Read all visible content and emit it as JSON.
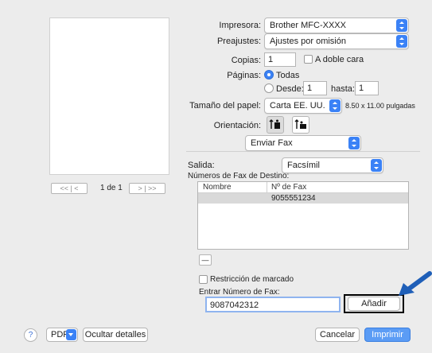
{
  "printer": {
    "label": "Impresora:",
    "value": "Brother MFC-XXXX"
  },
  "presets": {
    "label": "Preajustes:",
    "value": "Ajustes por omisión"
  },
  "copies": {
    "label": "Copias:",
    "value": "1",
    "duplex_label": "A doble cara"
  },
  "pages": {
    "label": "Páginas:",
    "all_label": "Todas",
    "from_label": "Desde:",
    "from_value": "1",
    "to_label": "hasta:",
    "to_value": "1"
  },
  "paper": {
    "label": "Tamaño del papel:",
    "value": "Carta EE. UU.",
    "dims": "8.50 x 11.00 pulgadas"
  },
  "orientation": {
    "label": "Orientación:"
  },
  "section": {
    "value": "Enviar Fax"
  },
  "output": {
    "label": "Salida:",
    "value": "Facsímil"
  },
  "fax_table": {
    "title": "Números de Fax de Destino:",
    "col_name": "Nombre",
    "col_fax": "Nº de Fax",
    "rows": [
      {
        "name": "",
        "fax": "9055551234"
      }
    ]
  },
  "remove_button": "—",
  "dial_restriction": {
    "label": "Restricción de marcado"
  },
  "enter_fax": {
    "label": "Entrar Número de Fax:",
    "value": "9087042312",
    "add_label": "Añadir"
  },
  "pager": {
    "first_prev": "<<",
    "prev": "<",
    "text": "1 de 1",
    "next": ">",
    "last": ">>"
  },
  "bottom": {
    "help": "?",
    "pdf": "PDF",
    "hide_details": "Ocultar detalles",
    "cancel": "Cancelar",
    "print": "Imprimir"
  },
  "colors": {
    "accent": "#3b82f6",
    "arrow": "#1f5fb8"
  }
}
